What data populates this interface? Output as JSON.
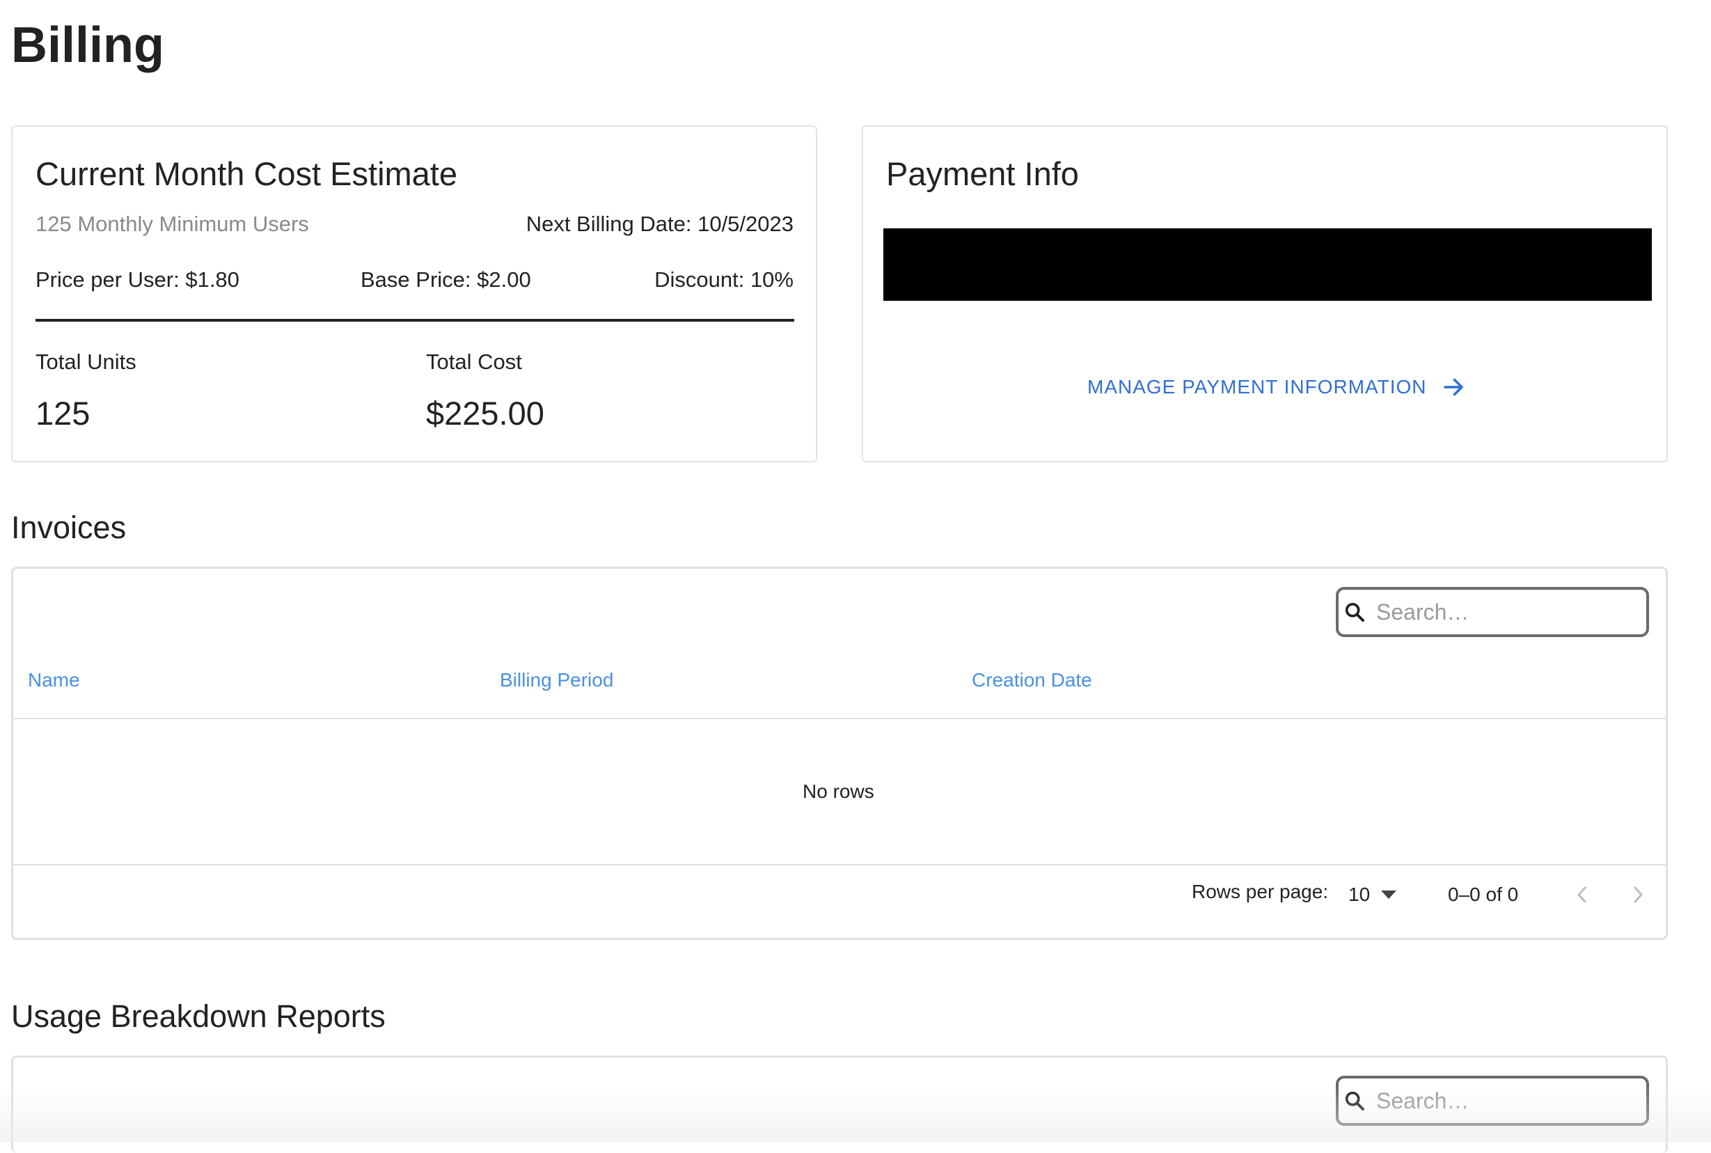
{
  "page": {
    "title": "Billing"
  },
  "cost_card": {
    "title": "Current Month Cost Estimate",
    "minimum_users": "125 Monthly Minimum Users",
    "next_billing": "Next Billing Date: 10/5/2023",
    "price_per_user": "Price per User: $1.80",
    "base_price": "Base Price: $2.00",
    "discount": "Discount: 10%",
    "total_units_label": "Total Units",
    "total_units_value": "125",
    "total_cost_label": "Total Cost",
    "total_cost_value": "$225.00"
  },
  "payment_card": {
    "title": "Payment Info",
    "manage_label": "MANAGE PAYMENT INFORMATION",
    "link_color": "#2f6fd6"
  },
  "invoices": {
    "title": "Invoices",
    "search_placeholder": "Search…",
    "columns": [
      "Name",
      "Billing Period",
      "Creation Date"
    ],
    "empty_text": "No rows",
    "rows_per_page_label": "Rows per page:",
    "rows_per_page_value": "10",
    "range_text": "0–0 of 0",
    "header_color": "#4a90e2"
  },
  "usage_reports": {
    "title": "Usage Breakdown Reports",
    "search_placeholder": "Search…"
  },
  "icons": {
    "manage_arrow": "arrow-right-icon",
    "search": "search-icon",
    "dropdown": "triangle-down-icon",
    "prev": "chevron-left-icon",
    "next": "chevron-right-icon"
  }
}
